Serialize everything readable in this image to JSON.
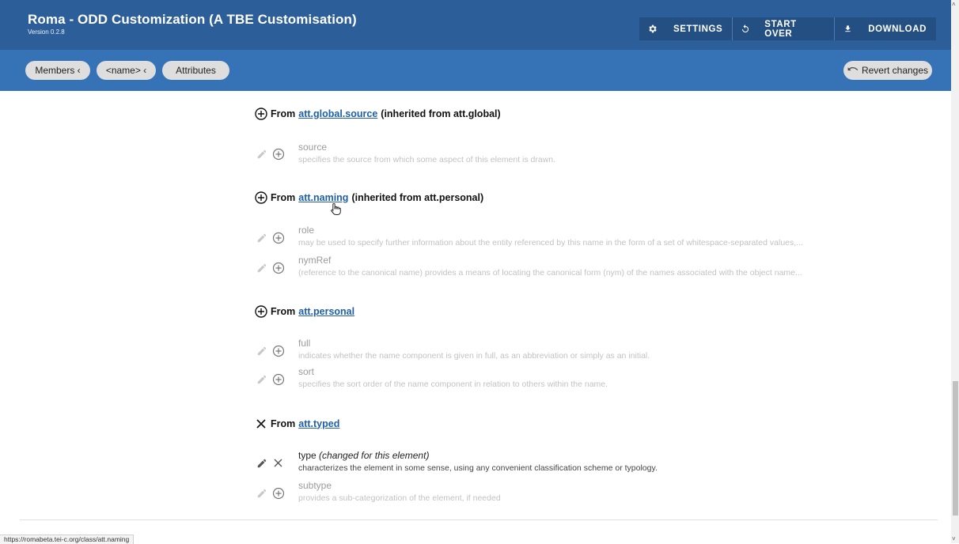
{
  "app": {
    "title": "Roma - ODD Customization (A TBE Customisation)",
    "version": "Version 0.2.8",
    "settings_label": "SETTINGS",
    "start_over_label": "START OVER",
    "download_label": "DOWNLOAD",
    "brand_color": "#2c5f9a"
  },
  "breadcrumb": {
    "members": "Members ‹",
    "name": "<name> ‹",
    "attributes": "Attributes"
  },
  "revert_label": "Revert changes",
  "sections": [
    {
      "icon": "circle-plus-icon",
      "prefix": "From",
      "link": "att.global.source",
      "suffix": "(inherited from att.global)",
      "attributes": [
        {
          "name": "source",
          "desc": "specifies the source from which some aspect of this element is drawn."
        }
      ]
    },
    {
      "icon": "circle-plus-icon",
      "prefix": "From",
      "link": "att.naming",
      "suffix": "(inherited from att.personal)",
      "attributes": [
        {
          "name": "role",
          "desc": "may be used to specify further information about the entity referenced by this name in the form of a set of whitespace-separated values,..."
        },
        {
          "name": "nymRef",
          "desc": "(reference to the canonical name) provides a means of locating the canonical form (nym) of the names associated with the object name..."
        }
      ]
    },
    {
      "icon": "circle-plus-icon",
      "prefix": "From",
      "link": "att.personal",
      "suffix": "",
      "attributes": [
        {
          "name": "full",
          "desc": "indicates whether the name component is given in full, as an abbreviation or simply as an initial."
        },
        {
          "name": "sort",
          "desc": "specifies the sort order of the name component in relation to others within the name."
        }
      ]
    },
    {
      "icon": "close-icon",
      "prefix": "From",
      "link": "att.typed",
      "suffix": "",
      "attributes": [
        {
          "name": "type",
          "changed_note": "(changed for this element)",
          "desc": "characterizes the element in some sense, using any convenient classification scheme or typology."
        },
        {
          "name": "subtype",
          "desc": "provides a sub-categorization of the element, if needed"
        }
      ]
    }
  ],
  "status_url": "https://romabeta.tei-c.org/class/att.naming"
}
